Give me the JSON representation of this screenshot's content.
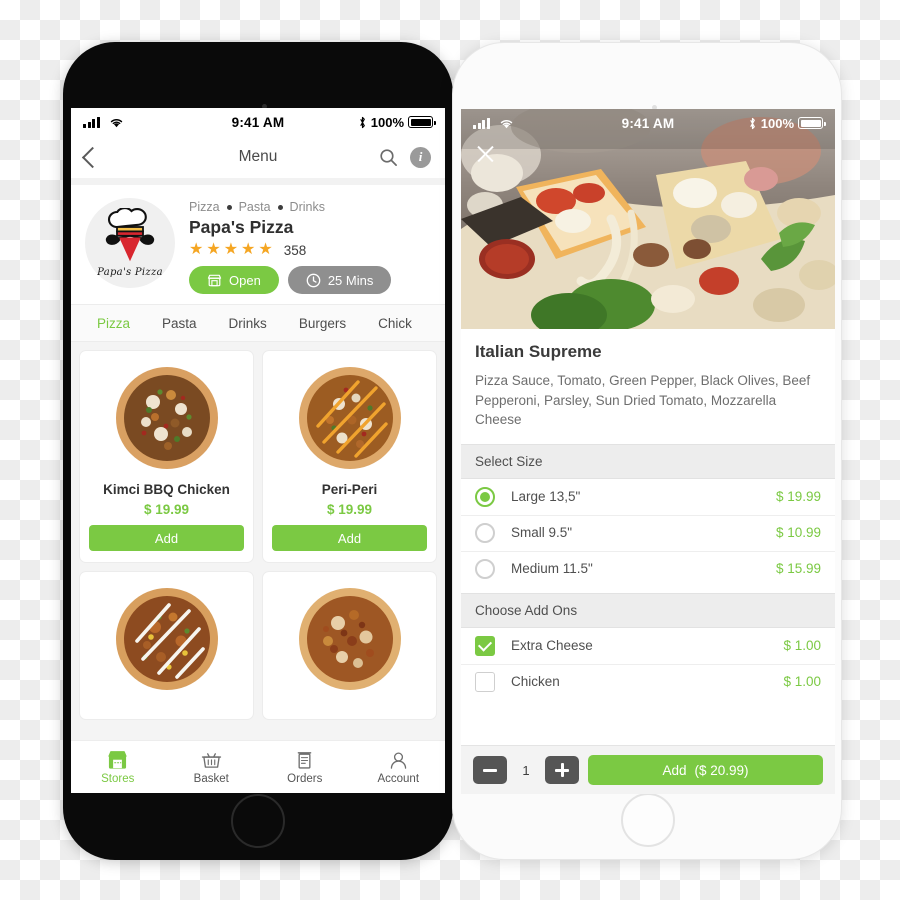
{
  "colors": {
    "accent_green": "#7bc943",
    "star_orange": "#f5a623",
    "grey_pill": "#8f8f8f",
    "section_grey": "#ededed"
  },
  "left_phone": {
    "status_bar": {
      "time": "9:41 AM",
      "battery_pct": "100%",
      "signal_icon": "signal-bars-icon",
      "wifi_icon": "wifi-icon",
      "bluetooth_icon": "bluetooth-icon",
      "battery_icon": "battery-full-icon"
    },
    "nav": {
      "back_icon": "chevron-left-icon",
      "title": "Menu",
      "search_icon": "search-icon",
      "info_icon": "info-icon",
      "info_glyph": "i"
    },
    "store": {
      "logo_word": "Papa's Pizza",
      "categories": [
        "Pizza",
        "Pasta",
        "Drinks"
      ],
      "name": "Papa's Pizza",
      "stars": 5,
      "star_glyph": "★",
      "rating_count": "358",
      "open_label": "Open",
      "open_icon": "storefront-icon",
      "time_label": "25 Mins",
      "time_icon": "clock-icon"
    },
    "tabs": [
      {
        "label": "Pizza",
        "active": true
      },
      {
        "label": "Pasta",
        "active": false
      },
      {
        "label": "Drinks",
        "active": false
      },
      {
        "label": "Burgers",
        "active": false
      },
      {
        "label": "Chick",
        "active": false
      }
    ],
    "dishes": [
      {
        "name": "Kimci BBQ Chicken",
        "price": "$ 19.99",
        "add_label": "Add",
        "image": "pizza-kimci-bbq-chicken"
      },
      {
        "name": "Peri-Peri",
        "price": "$ 19.99",
        "add_label": "Add",
        "image": "pizza-peri-peri"
      },
      {
        "name": "",
        "price": "",
        "add_label": "",
        "image": "pizza-ranch-drizzle"
      },
      {
        "name": "",
        "price": "",
        "add_label": "",
        "image": "pizza-meat-feast"
      }
    ],
    "bottom_nav": [
      {
        "label": "Stores",
        "icon": "store-icon",
        "active": true
      },
      {
        "label": "Basket",
        "icon": "basket-icon",
        "active": false
      },
      {
        "label": "Orders",
        "icon": "receipt-icon",
        "active": false
      },
      {
        "label": "Account",
        "icon": "person-icon",
        "active": false
      }
    ]
  },
  "right_phone": {
    "status_bar": {
      "time": "9:41 AM",
      "battery_pct": "100%",
      "signal_icon": "signal-bars-icon",
      "wifi_icon": "wifi-icon",
      "bluetooth_icon": "bluetooth-icon",
      "battery_icon": "battery-full-icon"
    },
    "hero": {
      "close_icon": "close-icon",
      "image": "italian-supreme-pizza-photo"
    },
    "detail": {
      "title": "Italian Supreme",
      "description": "Pizza Sauce, Tomato, Green Pepper, Black Olives, Beef Pepperoni, Parsley, Sun Dried Tomato, Mozzarella Cheese"
    },
    "size_section": {
      "heading": "Select Size",
      "options": [
        {
          "label": "Large 13,5\"",
          "price": "$ 19.99",
          "selected": true
        },
        {
          "label": "Small 9.5\"",
          "price": "$ 10.99",
          "selected": false
        },
        {
          "label": "Medium 11.5\"",
          "price": "$ 15.99",
          "selected": false
        }
      ]
    },
    "addons_section": {
      "heading": "Choose Add Ons",
      "options": [
        {
          "label": "Extra Cheese",
          "price": "$ 1.00",
          "checked": true
        },
        {
          "label": "Chicken",
          "price": "$ 1.00",
          "checked": false
        }
      ]
    },
    "cart_bar": {
      "minus_icon": "minus-icon",
      "plus_icon": "plus-icon",
      "quantity": "1",
      "add_label": "Add",
      "add_total": "($ 20.99)"
    }
  }
}
